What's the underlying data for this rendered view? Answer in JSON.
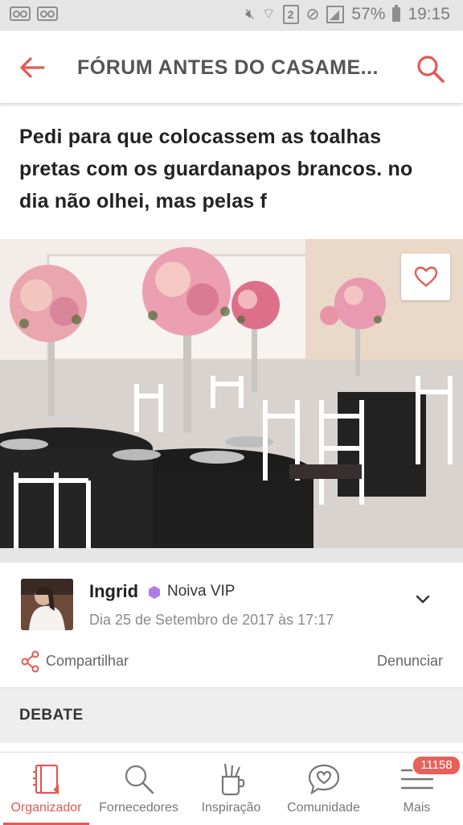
{
  "status_bar": {
    "battery": "57%",
    "time": "19:15",
    "sim": "2"
  },
  "header": {
    "title": "FÓRUM ANTES DO CASAME...",
    "back_icon": "arrow-left-icon",
    "search_icon": "search-icon"
  },
  "post": {
    "title": "Pedi para que colocassem as toalhas pretas com os guardanapos brancos. no dia não olhei, mas pelas f",
    "image_alt": "wedding-tables-photo",
    "author": "Ingrid",
    "badge": "Noiva VIP",
    "date": "Dia 25 de Setembro de 2017 às 17:17",
    "share_label": "Compartilhar",
    "report_label": "Denunciar"
  },
  "section": {
    "debate_label": "DEBATE"
  },
  "tabbar": {
    "tabs": [
      {
        "label": "Organizador",
        "icon": "notebook-icon",
        "active": true
      },
      {
        "label": "Fornecedores",
        "icon": "search-icon",
        "active": false
      },
      {
        "label": "Inspiração",
        "icon": "paint-cup-icon",
        "active": false
      },
      {
        "label": "Comunidade",
        "icon": "chat-heart-icon",
        "active": false
      },
      {
        "label": "Mais",
        "icon": "menu-icon",
        "active": false
      }
    ],
    "badge": "11158"
  },
  "colors": {
    "accent": "#e05a52",
    "header_text": "#555555",
    "badge": "#e8605a"
  }
}
